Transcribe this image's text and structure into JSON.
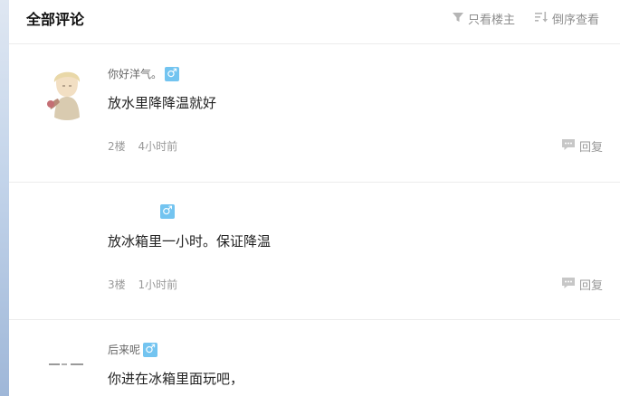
{
  "header": {
    "title": "全部评论",
    "filter_label": "只看楼主",
    "sort_label": "倒序查看"
  },
  "comments": [
    {
      "username": "你好洋气。",
      "gender": "♂",
      "content": "放水里降降温就好",
      "floor": "2楼",
      "time": "4小时前",
      "reply_label": "回复"
    },
    {
      "username": "",
      "gender": "♂",
      "content": "放冰箱里一小时。保证降温",
      "floor": "3楼",
      "time": "1小时前",
      "reply_label": "回复"
    },
    {
      "username": "后来呢",
      "gender": "♂",
      "content": "你进在冰箱里面玩吧，"
    }
  ],
  "colors": {
    "gender_badge": "#73c4f0",
    "muted_text": "#999999",
    "divider": "#ececec"
  }
}
